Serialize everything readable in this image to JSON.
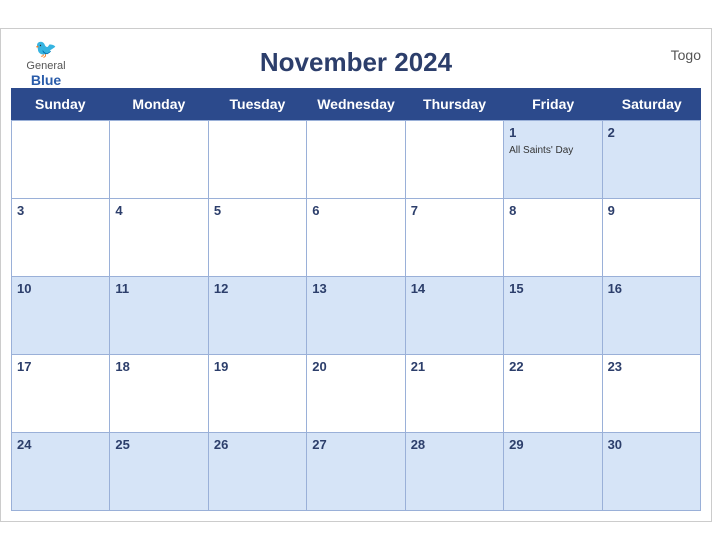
{
  "header": {
    "logo_general": "General",
    "logo_blue": "Blue",
    "title": "November 2024",
    "country": "Togo"
  },
  "days": [
    "Sunday",
    "Monday",
    "Tuesday",
    "Wednesday",
    "Thursday",
    "Friday",
    "Saturday"
  ],
  "weeks": [
    [
      {
        "date": "",
        "empty": true
      },
      {
        "date": "",
        "empty": true
      },
      {
        "date": "",
        "empty": true
      },
      {
        "date": "",
        "empty": true
      },
      {
        "date": "",
        "empty": true
      },
      {
        "date": "1",
        "event": "All Saints' Day"
      },
      {
        "date": "2",
        "event": ""
      }
    ],
    [
      {
        "date": "3",
        "event": ""
      },
      {
        "date": "4",
        "event": ""
      },
      {
        "date": "5",
        "event": ""
      },
      {
        "date": "6",
        "event": ""
      },
      {
        "date": "7",
        "event": ""
      },
      {
        "date": "8",
        "event": ""
      },
      {
        "date": "9",
        "event": ""
      }
    ],
    [
      {
        "date": "10",
        "event": ""
      },
      {
        "date": "11",
        "event": ""
      },
      {
        "date": "12",
        "event": ""
      },
      {
        "date": "13",
        "event": ""
      },
      {
        "date": "14",
        "event": ""
      },
      {
        "date": "15",
        "event": ""
      },
      {
        "date": "16",
        "event": ""
      }
    ],
    [
      {
        "date": "17",
        "event": ""
      },
      {
        "date": "18",
        "event": ""
      },
      {
        "date": "19",
        "event": ""
      },
      {
        "date": "20",
        "event": ""
      },
      {
        "date": "21",
        "event": ""
      },
      {
        "date": "22",
        "event": ""
      },
      {
        "date": "23",
        "event": ""
      }
    ],
    [
      {
        "date": "24",
        "event": ""
      },
      {
        "date": "25",
        "event": ""
      },
      {
        "date": "26",
        "event": ""
      },
      {
        "date": "27",
        "event": ""
      },
      {
        "date": "28",
        "event": ""
      },
      {
        "date": "29",
        "event": ""
      },
      {
        "date": "30",
        "event": ""
      }
    ]
  ],
  "colors": {
    "header_bg": "#2c4a8c",
    "cell_blue": "#d6e4f7",
    "cell_white": "#ffffff",
    "title_color": "#2c3e6b"
  }
}
